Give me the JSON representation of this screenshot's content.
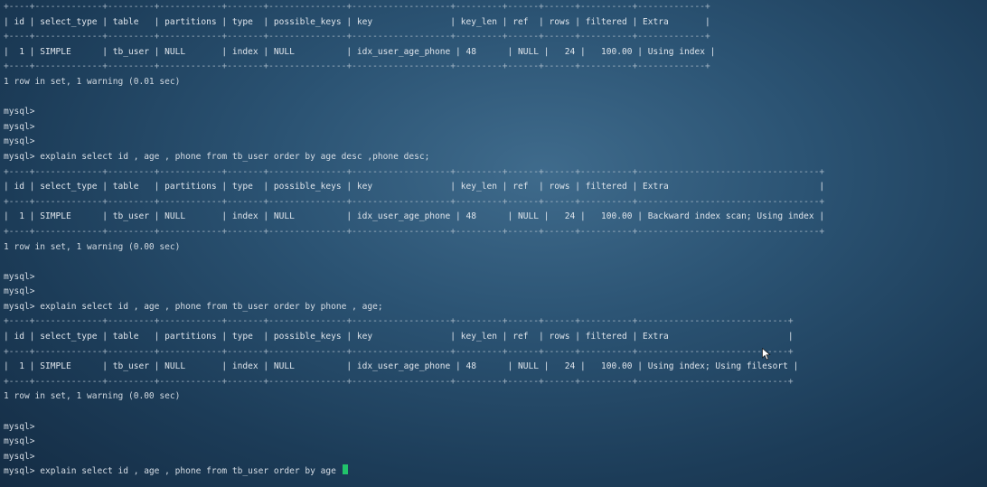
{
  "terminal": {
    "lines": [
      {
        "kind": "sep",
        "text": "+----+-------------+---------+------------+-------+---------------+-------------------+---------+------+------+----------+-------------+"
      },
      {
        "kind": "hdr",
        "text": "| id | select_type | table   | partitions | type  | possible_keys | key               | key_len | ref  | rows | filtered | Extra       |"
      },
      {
        "kind": "sep",
        "text": "+----+-------------+---------+------------+-------+---------------+-------------------+---------+------+------+----------+-------------+"
      },
      {
        "kind": "row",
        "text": "|  1 | SIMPLE      | tb_user | NULL       | index | NULL          | idx_user_age_phone | 48      | NULL |   24 |   100.00 | Using index |"
      },
      {
        "kind": "sep",
        "text": "+----+-------------+---------+------------+-------+---------------+-------------------+---------+------+------+----------+-------------+"
      },
      {
        "kind": "status",
        "text": "1 row in set, 1 warning (0.01 sec)"
      },
      {
        "kind": "blank",
        "text": ""
      },
      {
        "kind": "prompt",
        "text": "mysql>"
      },
      {
        "kind": "prompt",
        "text": "mysql>"
      },
      {
        "kind": "prompt",
        "text": "mysql>"
      },
      {
        "kind": "prompt",
        "text": "mysql> explain select id , age , phone from tb_user order by age desc ,phone desc;"
      },
      {
        "kind": "sep",
        "text": "+----+-------------+---------+------------+-------+---------------+-------------------+---------+------+------+----------+-----------------------------------+"
      },
      {
        "kind": "hdr",
        "text": "| id | select_type | table   | partitions | type  | possible_keys | key               | key_len | ref  | rows | filtered | Extra                             |"
      },
      {
        "kind": "sep",
        "text": "+----+-------------+---------+------------+-------+---------------+-------------------+---------+------+------+----------+-----------------------------------+"
      },
      {
        "kind": "row",
        "text": "|  1 | SIMPLE      | tb_user | NULL       | index | NULL          | idx_user_age_phone | 48      | NULL |   24 |   100.00 | Backward index scan; Using index |"
      },
      {
        "kind": "sep",
        "text": "+----+-------------+---------+------------+-------+---------------+-------------------+---------+------+------+----------+-----------------------------------+"
      },
      {
        "kind": "status",
        "text": "1 row in set, 1 warning (0.00 sec)"
      },
      {
        "kind": "blank",
        "text": ""
      },
      {
        "kind": "prompt",
        "text": "mysql>"
      },
      {
        "kind": "prompt",
        "text": "mysql>"
      },
      {
        "kind": "prompt",
        "text": "mysql> explain select id , age , phone from tb_user order by phone , age;"
      },
      {
        "kind": "sep",
        "text": "+----+-------------+---------+------------+-------+---------------+-------------------+---------+------+------+----------+-----------------------------+"
      },
      {
        "kind": "hdr",
        "text": "| id | select_type | table   | partitions | type  | possible_keys | key               | key_len | ref  | rows | filtered | Extra                       |"
      },
      {
        "kind": "sep",
        "text": "+----+-------------+---------+------------+-------+---------------+-------------------+---------+------+------+----------+-----------------------------+"
      },
      {
        "kind": "row",
        "text": "|  1 | SIMPLE      | tb_user | NULL       | index | NULL          | idx_user_age_phone | 48      | NULL |   24 |   100.00 | Using index; Using filesort |"
      },
      {
        "kind": "sep",
        "text": "+----+-------------+---------+------------+-------+---------------+-------------------+---------+------+------+----------+-----------------------------+"
      },
      {
        "kind": "status",
        "text": "1 row in set, 1 warning (0.00 sec)"
      },
      {
        "kind": "blank",
        "text": ""
      },
      {
        "kind": "prompt",
        "text": "mysql>"
      },
      {
        "kind": "prompt",
        "text": "mysql>"
      },
      {
        "kind": "prompt",
        "text": "mysql>"
      }
    ],
    "input_line": "mysql> explain select id , age , phone from tb_user order by age ",
    "cursor_color": "#21c46b"
  }
}
